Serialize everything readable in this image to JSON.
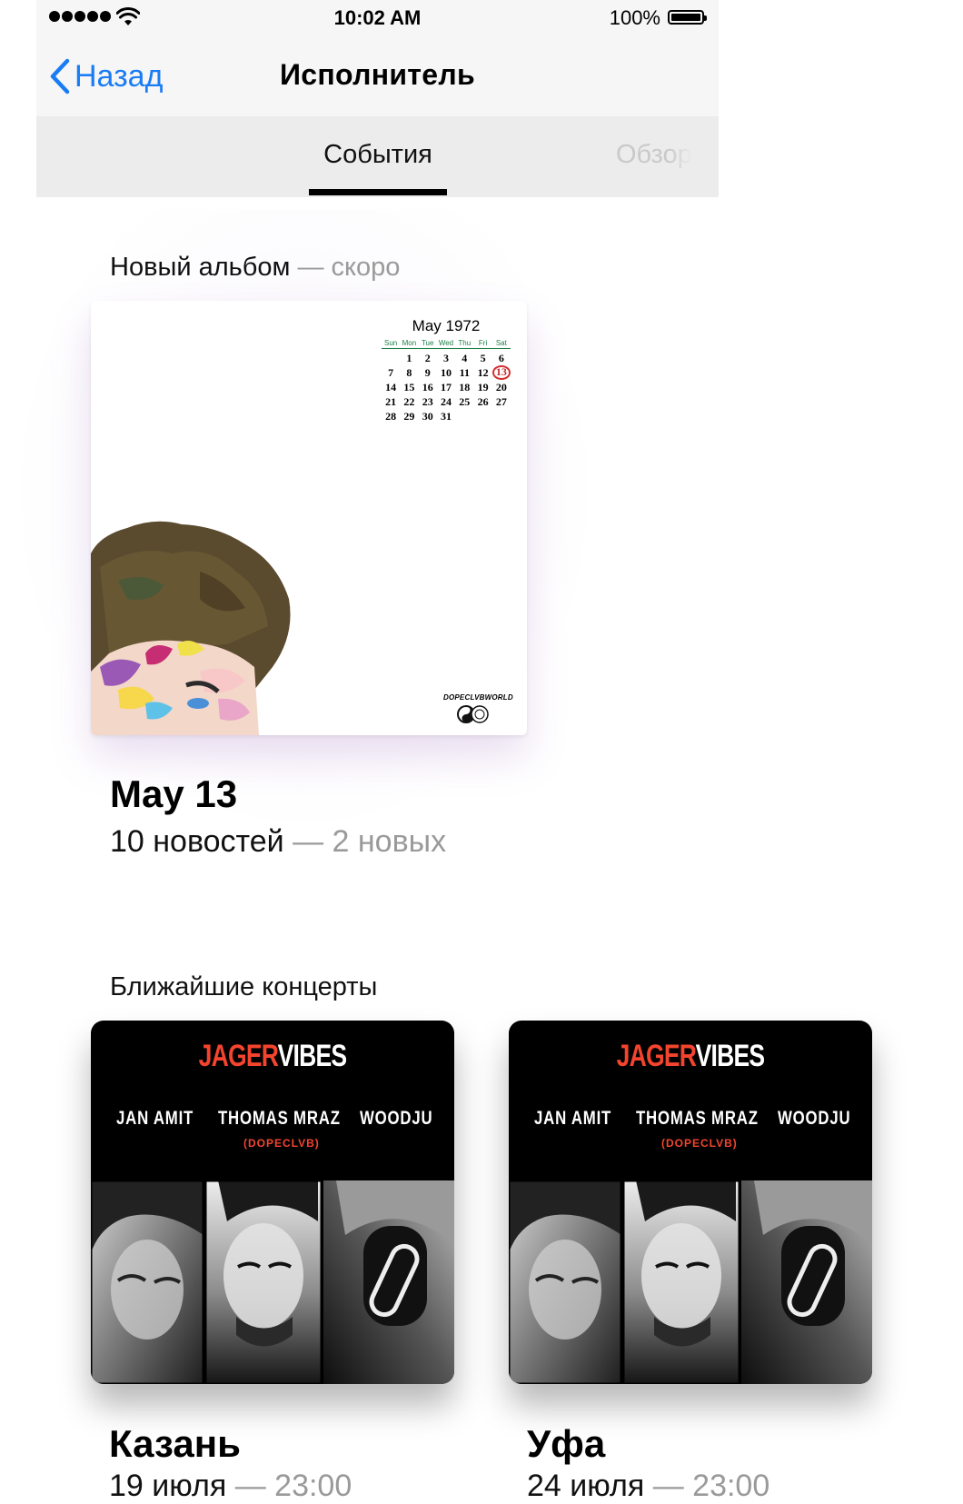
{
  "status_bar": {
    "time": "10:02 AM",
    "battery": "100%"
  },
  "nav": {
    "back_label": "Назад",
    "title": "Исполнитель"
  },
  "segments": {
    "events": "События",
    "overview": "Обзор",
    "active": "events"
  },
  "album_section": {
    "label": "Новый альбом",
    "label_suffix": " — скоро",
    "cover": {
      "calendar_title": "May 1972",
      "weekdays": [
        "Sun",
        "Mon",
        "Tue",
        "Wed",
        "Thu",
        "Fri",
        "Sat"
      ],
      "highlighted_day": 13,
      "brand": "DOPECLVBWORLD"
    },
    "date": "May 13",
    "news": "10 новостей",
    "news_suffix": " — 2 новых"
  },
  "concerts_section": {
    "label": "Ближайшие концерты",
    "poster": {
      "title_red": "JAGER",
      "title_white": "VIBES",
      "artists": [
        "JAN AMIT",
        "THOMAS MRAZ",
        "WOODJU"
      ],
      "artist_sub": "(DOPECLVB)"
    },
    "items": [
      {
        "city": "Казань",
        "date": "19 июля",
        "time_suffix": " — 23:00"
      },
      {
        "city": "Уфа",
        "date": "24 июля",
        "time_suffix": " — 23:00"
      }
    ]
  },
  "colors": {
    "accent_blue": "#1a7cf5",
    "poster_red": "#f4442e",
    "muted_text": "#9a9a9a"
  }
}
